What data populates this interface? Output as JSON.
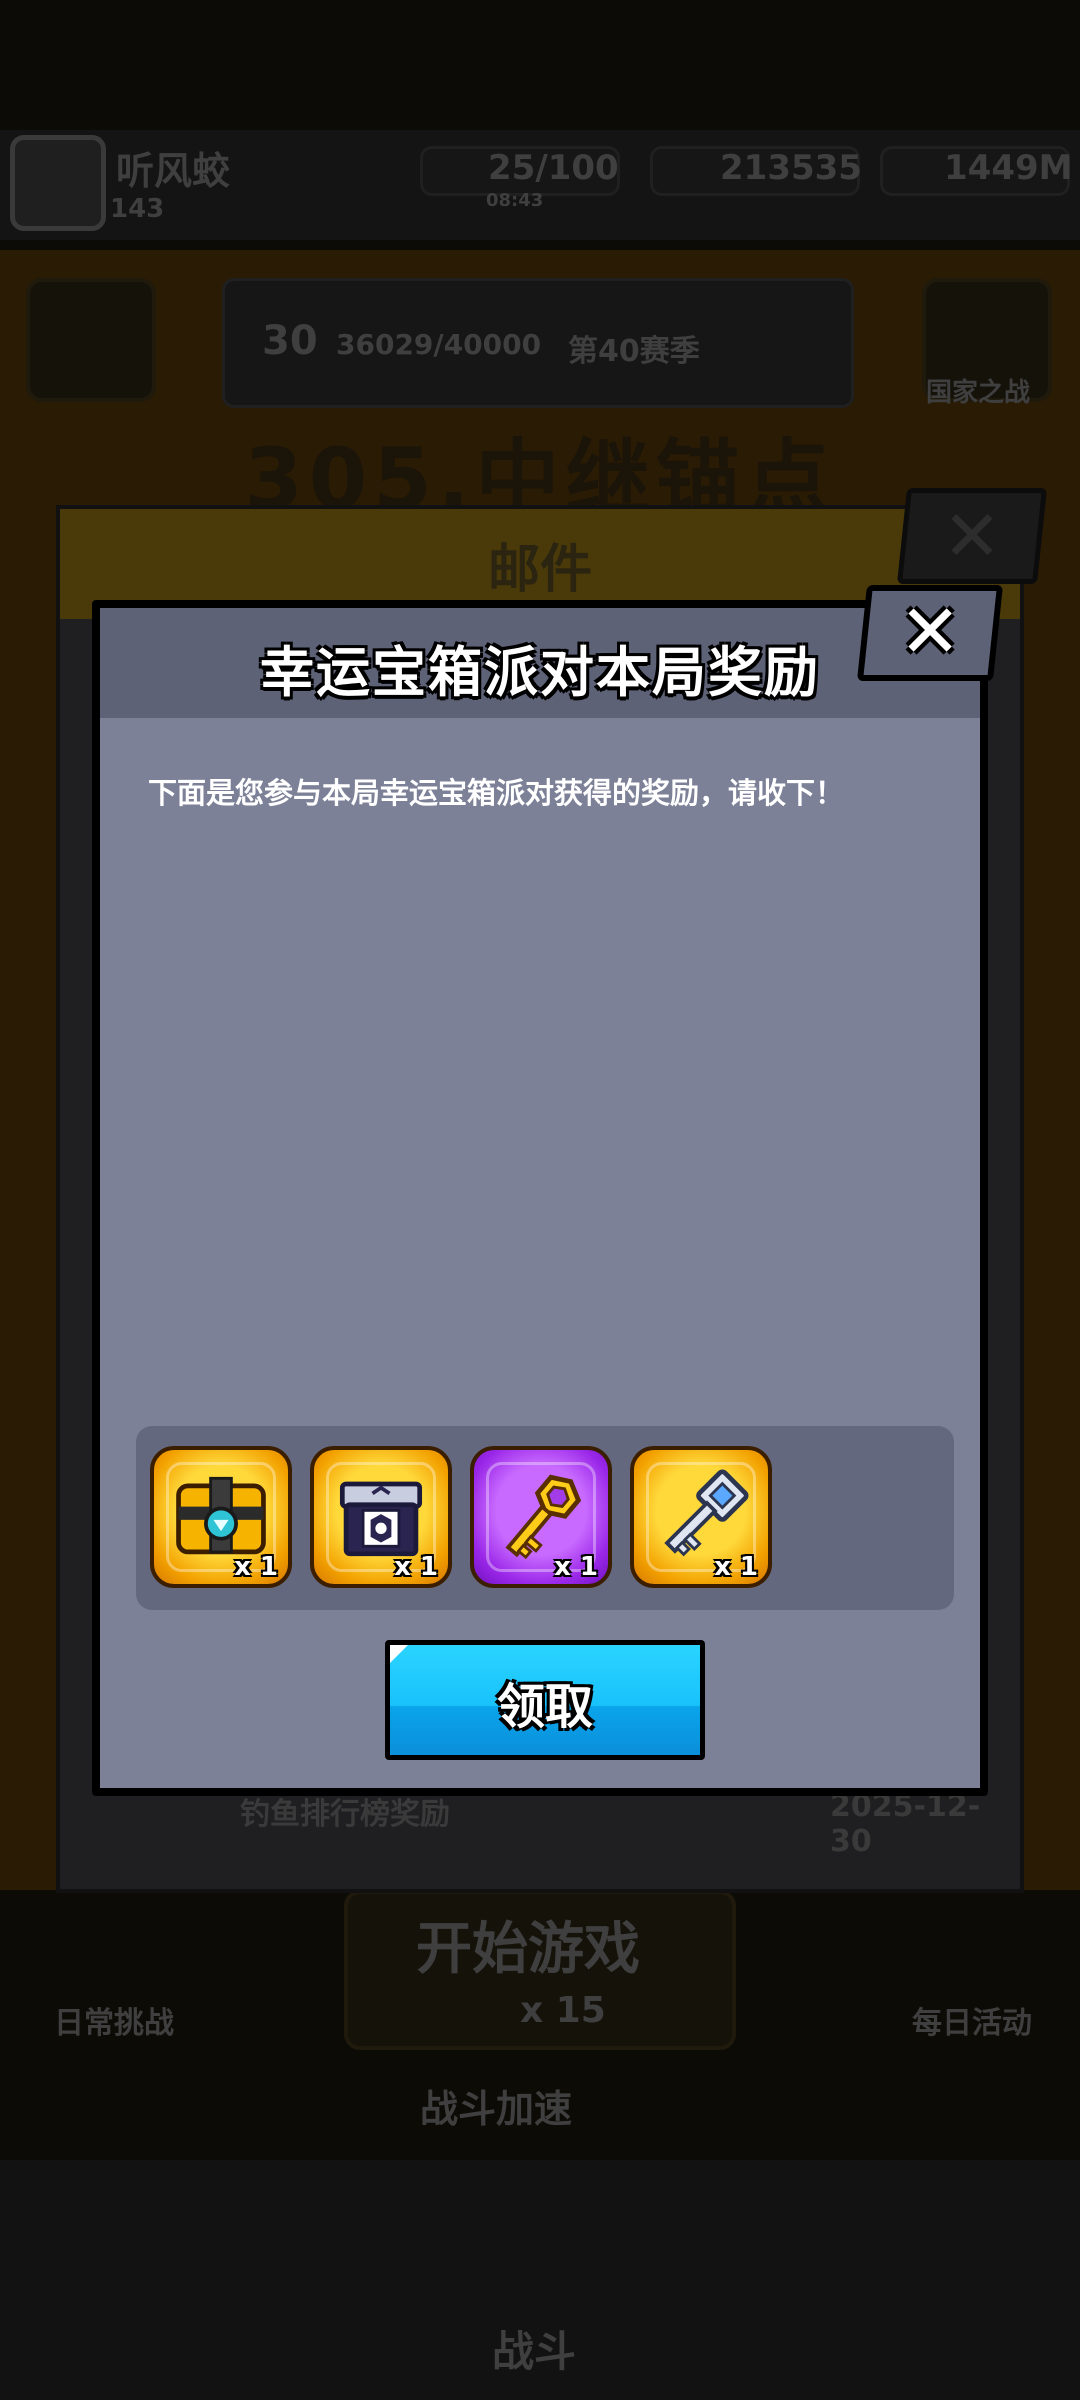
{
  "background": {
    "player_name": "听风蛟",
    "player_level": "143",
    "energy": "25/100",
    "energy_timer": "08:43",
    "coins": "213535",
    "gems": "1449M",
    "promo_text": "30",
    "promo_mid": "36029/40000",
    "promo_right": "第40赛季",
    "side_label": "国家之战",
    "stage_title": "305.中继锚点",
    "mail_title": "邮件",
    "mail_last_item": "钓鱼排行榜奖励",
    "mail_last_date": "2025-12-30",
    "start_game": "开始游戏",
    "start_cost": "x 15",
    "boost": "战斗加速",
    "daily": "日常挑战",
    "events": "每日活动",
    "battle": "战斗"
  },
  "dialog": {
    "title": "幸运宝箱派对本局奖励",
    "close_icon": "close-icon",
    "message": "下面是您参与本局幸运宝箱派对获得的奖励，请收下！",
    "rewards": [
      {
        "name": "gold-chest",
        "icon": "treasure-chest-icon",
        "count": "x 1",
        "frame": "gold"
      },
      {
        "name": "gear-box",
        "icon": "gear-box-icon",
        "count": "x 1",
        "frame": "gold"
      },
      {
        "name": "gold-key",
        "icon": "golden-key-icon",
        "count": "x 1",
        "frame": "purple"
      },
      {
        "name": "silver-key",
        "icon": "silver-key-icon",
        "count": "x 1",
        "frame": "gold"
      }
    ],
    "claim_label": "领取"
  },
  "colors": {
    "dialog_body": "#7c8197",
    "dialog_header": "#5e6277",
    "claim_button": "#19c2fb",
    "gold_frame": "#ffc21a",
    "purple_frame": "#a030ee"
  }
}
